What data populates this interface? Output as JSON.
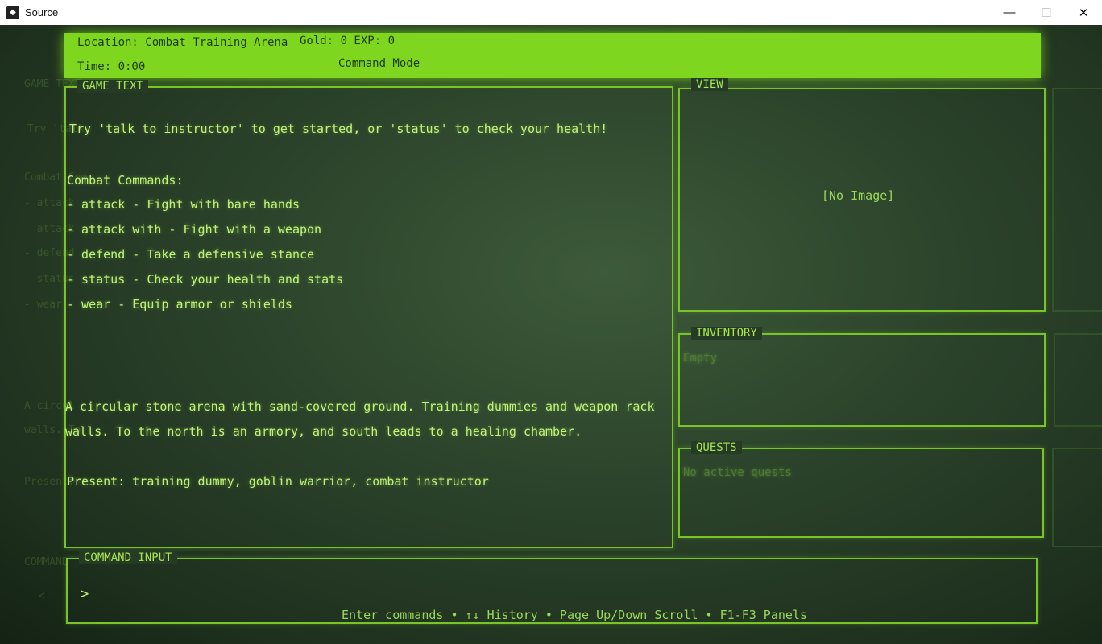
{
  "window": {
    "title": "Source",
    "minimize": "—",
    "maximize": "☐",
    "close": "✕"
  },
  "header": {
    "location": "Location: Combat Training Arena",
    "gold_exp": "Gold: 0 EXP: 0",
    "time": "Time: 0:00",
    "mode": "Command Mode"
  },
  "game_text": {
    "title": "GAME TEXT",
    "lines": [
      "Try 'talk to instructor' to get started, or 'status' to check your health!",
      "Combat Commands:",
      "- attack  - Fight with bare hands",
      "- attack  with  - Fight with a weapon",
      "- defend - Take a defensive stance",
      "- status - Check your health and stats",
      "- wear  - Equip armor or shields",
      "A circular stone arena with sand-covered ground. Training dummies and weapon racks line th",
      "walls. To the north is an armory, and south leads to a healing chamber.",
      "Present: training dummy, goblin warrior, combat instructor"
    ]
  },
  "view": {
    "title": "VIEW",
    "placeholder": "[No Image]"
  },
  "inventory": {
    "title": "INVENTORY",
    "content": "Empty"
  },
  "quests": {
    "title": "QUESTS",
    "content": "No active quests"
  },
  "command": {
    "title": "COMMAND INPUT",
    "prompt": ">",
    "footer": "Enter commands • ↑↓ History • Page Up/Down Scroll • F1-F3 Panels"
  },
  "ghost_left": {
    "lines": [
      "GAME TEXT",
      "Try 'talk",
      "Combat Com",
      "- attack",
      "- attack",
      "- defend",
      "- status",
      "- wear",
      "A circul",
      "walls. To",
      "Present: t",
      "COMMAND",
      "<"
    ]
  },
  "colors": {
    "accent": "#7ed61e",
    "text": "#c2f27a",
    "background": "#2c442b"
  }
}
